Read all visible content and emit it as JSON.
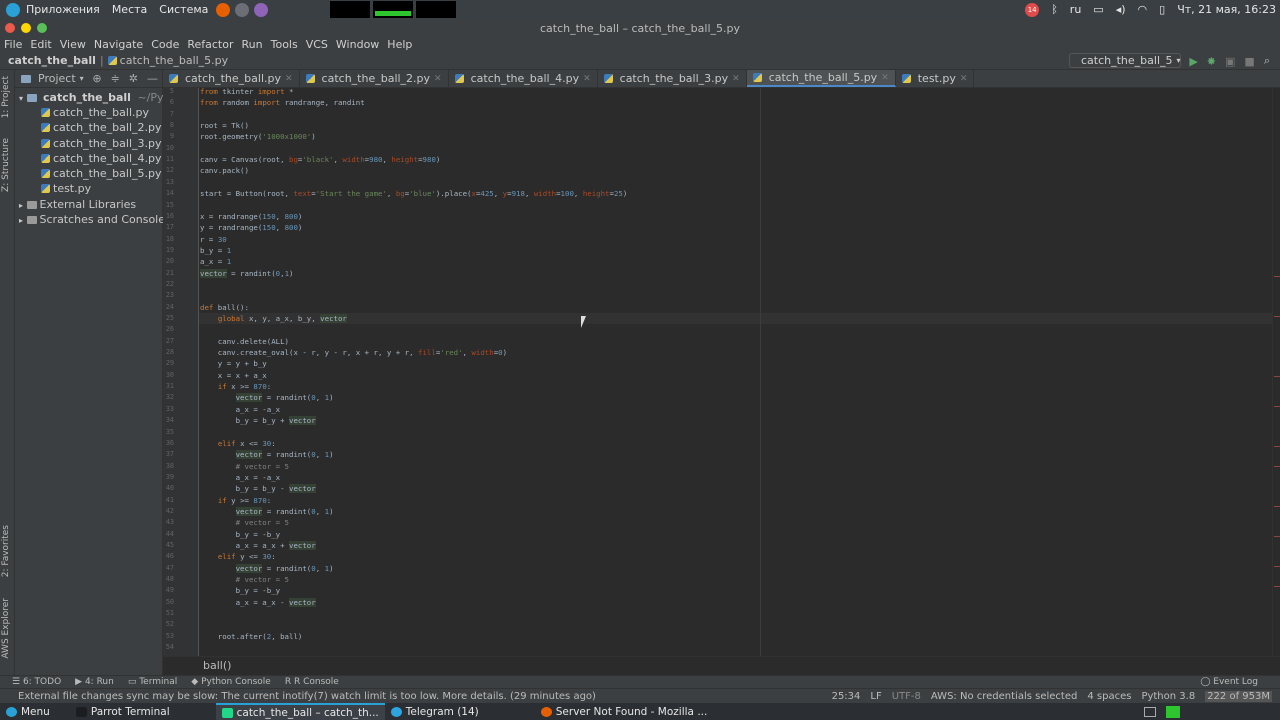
{
  "desktop": {
    "menu": [
      "Приложения",
      "Места",
      "Система"
    ],
    "lang": "ru",
    "clock": "Чт, 21 мая, 16:23",
    "notif_count": "14"
  },
  "window": {
    "title": "catch_the_ball – catch_the_ball_5.py"
  },
  "menubar": [
    "File",
    "Edit",
    "View",
    "Navigate",
    "Code",
    "Refactor",
    "Run",
    "Tools",
    "VCS",
    "Window",
    "Help"
  ],
  "navbar": {
    "project": "catch_the_ball",
    "file": "catch_the_ball_5.py",
    "run_config": "catch_the_ball_5"
  },
  "left_stripe": {
    "project": "1: Project",
    "structure": "Z: Structure",
    "favorites": "2: Favorites",
    "aws": "AWS Explorer"
  },
  "project_panel": {
    "header": "Project",
    "root": "catch_the_ball",
    "root_path": "~/Pycharm",
    "files": [
      "catch_the_ball.py",
      "catch_the_ball_2.py",
      "catch_the_ball_3.py",
      "catch_the_ball_4.py",
      "catch_the_ball_5.py",
      "test.py"
    ],
    "external": "External Libraries",
    "scratches": "Scratches and Consoles"
  },
  "tabs": [
    "catch_the_ball.py",
    "catch_the_ball_2.py",
    "catch_the_ball_4.py",
    "catch_the_ball_3.py",
    "catch_the_ball_5.py",
    "test.py"
  ],
  "active_tab": 4,
  "code_lines": [
    {
      "n": "5",
      "t": "from tkinter import *"
    },
    {
      "n": "6",
      "t": "from random import randrange, randint"
    },
    {
      "n": "7",
      "t": ""
    },
    {
      "n": "8",
      "t": "root = Tk()"
    },
    {
      "n": "9",
      "t": "root.geometry('1000x1000')"
    },
    {
      "n": "10",
      "t": ""
    },
    {
      "n": "11",
      "t": "canv = Canvas(root, bg='black', width=980, height=980)"
    },
    {
      "n": "12",
      "t": "canv.pack()"
    },
    {
      "n": "13",
      "t": ""
    },
    {
      "n": "14",
      "t": "start = Button(root, text='Start the game', bg='blue').place(x=425, y=918, width=100, height=25)"
    },
    {
      "n": "15",
      "t": ""
    },
    {
      "n": "16",
      "t": "x = randrange(150, 800)"
    },
    {
      "n": "17",
      "t": "y = randrange(150, 800)"
    },
    {
      "n": "18",
      "t": "r = 30"
    },
    {
      "n": "19",
      "t": "b_y = 1"
    },
    {
      "n": "20",
      "t": "a_x = 1"
    },
    {
      "n": "21",
      "t": "vector = randint(0,1)"
    },
    {
      "n": "22",
      "t": ""
    },
    {
      "n": "23",
      "t": ""
    },
    {
      "n": "24",
      "t": "def ball():"
    },
    {
      "n": "25",
      "t": "    global x, y, a_x, b_y, vector"
    },
    {
      "n": "26",
      "t": ""
    },
    {
      "n": "27",
      "t": "    canv.delete(ALL)"
    },
    {
      "n": "28",
      "t": "    canv.create_oval(x - r, y - r, x + r, y + r, fill='red', width=0)"
    },
    {
      "n": "29",
      "t": "    y = y + b_y"
    },
    {
      "n": "30",
      "t": "    x = x + a_x"
    },
    {
      "n": "31",
      "t": "    if x >= 870:"
    },
    {
      "n": "32",
      "t": "        vector = randint(0, 1)"
    },
    {
      "n": "33",
      "t": "        a_x = -a_x"
    },
    {
      "n": "34",
      "t": "        b_y = b_y + vector"
    },
    {
      "n": "35",
      "t": ""
    },
    {
      "n": "36",
      "t": "    elif x <= 30:"
    },
    {
      "n": "37",
      "t": "        vector = randint(0, 1)"
    },
    {
      "n": "38",
      "t": "        # vector = 5"
    },
    {
      "n": "39",
      "t": "        a_x = -a_x"
    },
    {
      "n": "40",
      "t": "        b_y = b_y - vector"
    },
    {
      "n": "41",
      "t": "    if y >= 870:"
    },
    {
      "n": "42",
      "t": "        vector = randint(0, 1)"
    },
    {
      "n": "43",
      "t": "        # vector = 5"
    },
    {
      "n": "44",
      "t": "        b_y = -b_y"
    },
    {
      "n": "45",
      "t": "        a_x = a_x + vector"
    },
    {
      "n": "46",
      "t": "    elif y <= 30:"
    },
    {
      "n": "47",
      "t": "        vector = randint(0, 1)"
    },
    {
      "n": "48",
      "t": "        # vector = 5"
    },
    {
      "n": "49",
      "t": "        b_y = -b_y"
    },
    {
      "n": "50",
      "t": "        a_x = a_x - vector"
    },
    {
      "n": "51",
      "t": ""
    },
    {
      "n": "52",
      "t": ""
    },
    {
      "n": "53",
      "t": "    root.after(2, ball)"
    },
    {
      "n": "54",
      "t": ""
    }
  ],
  "breadcrumb": "ball()",
  "tool_windows": [
    "6: TODO",
    "4: Run",
    "Terminal",
    "Python Console",
    "R Console"
  ],
  "event_log": "Event Log",
  "status": {
    "message": "External file changes sync may be slow: The current inotify(7) watch limit is too low. More details. (29 minutes ago)",
    "position": "25:34",
    "line_sep": "LF",
    "encoding": "UTF-8",
    "aws": "AWS: No credentials selected",
    "indent": "4 spaces",
    "interpreter": "Python 3.8",
    "memory": "222 of 953M"
  },
  "taskbar": {
    "menu": "Menu",
    "items": [
      "Parrot Terminal",
      "catch_the_ball – catch_th...",
      "Telegram (14)",
      "Server Not Found - Mozilla ..."
    ]
  },
  "colors": {
    "accent": "#4a88c7",
    "keyword": "#cc7832",
    "string": "#6a8759",
    "number": "#6897bb",
    "comment": "#808080"
  }
}
